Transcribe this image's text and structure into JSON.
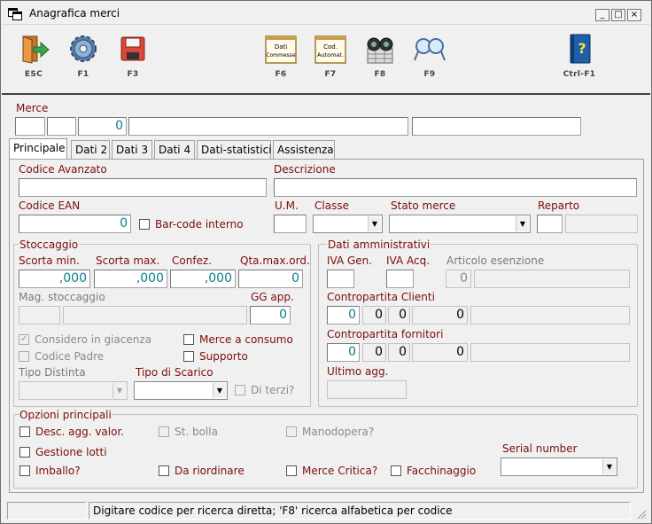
{
  "window": {
    "title": "Anagrafica merci",
    "controls": [
      "_",
      "□",
      "×"
    ]
  },
  "toolbar": [
    {
      "key": "ESC",
      "icon": "exit-door-icon"
    },
    {
      "key": "F1",
      "icon": "gear-icon"
    },
    {
      "key": "F3",
      "icon": "save-disk-icon"
    },
    {
      "key": "F6",
      "icon": "calendar-note-icon",
      "text": "Dati\nCommesse"
    },
    {
      "key": "F7",
      "icon": "calendar-note-icon",
      "text": "Cod.\nAutomat."
    },
    {
      "key": "F8",
      "icon": "binoculars-icon"
    },
    {
      "key": "F9",
      "icon": "search-glasses-icon"
    },
    {
      "key": "Ctrl-F1",
      "icon": "help-book-icon"
    }
  ],
  "merce": {
    "label": "Merce",
    "code_value": "0"
  },
  "tabs": [
    "Principale",
    "Dati 2",
    "Dati 3",
    "Dati 4",
    "Dati-statistici",
    "Assistenza"
  ],
  "principale": {
    "codice_avanzato": "Codice Avanzato",
    "descrizione": "Descrizione",
    "codice_ean": "Codice EAN",
    "codice_ean_value": "0",
    "barcode_interno": "Bar-code interno",
    "um": "U.M.",
    "classe": "Classe",
    "stato_merce": "Stato merce",
    "reparto": "Reparto",
    "stoccaggio": {
      "title": "Stoccaggio",
      "scorta_min": "Scorta min.",
      "scorta_min_value": ",000",
      "scorta_max": "Scorta max.",
      "scorta_max_value": ",000",
      "confez": "Confez.",
      "confez_value": ",000",
      "qta_max": "Qta.max.ord.",
      "qta_max_value": "0",
      "mag_stoccaggio": "Mag. stoccaggio",
      "gg_app": "GG app.",
      "gg_app_value": "0",
      "considero": "Considero in giacenza",
      "merce_consumo": "Merce a consumo",
      "codice_padre": "Codice Padre",
      "supporto": "Supporto",
      "tipo_distinta": "Tipo Distinta",
      "tipo_scarico": "Tipo di Scarico",
      "di_terzi": "Di terzi?"
    },
    "amministrativi": {
      "title": "Dati amministrativi",
      "iva_gen": "IVA Gen.",
      "iva_acq": "IVA Acq.",
      "articolo_esenzione": "Articolo esenzione",
      "esenzione_value": "0",
      "contropartita_clienti": "Contropartita Clienti",
      "clienti_values": [
        "0",
        "0",
        "0",
        "0"
      ],
      "contropartita_fornitori": "Contropartita fornitori",
      "fornitori_values": [
        "0",
        "0",
        "0",
        "0"
      ],
      "ultimo_agg": "Ultimo agg."
    },
    "opzioni": {
      "title": "Opzioni principali",
      "desc_agg": "Desc. agg. valor.",
      "st_bolla": "St. bolla",
      "manodopera": "Manodopera?",
      "gestione_lotti": "Gestione lotti",
      "serial_number": "Serial number",
      "imballo": "Imballo?",
      "da_riordinare": "Da riordinare",
      "merce_critica": "Merce Critica?",
      "facchinaggio": "Facchinaggio"
    }
  },
  "status": {
    "message": "Digitare codice per ricerca diretta; 'F8' ricerca alfabetica per codice"
  }
}
